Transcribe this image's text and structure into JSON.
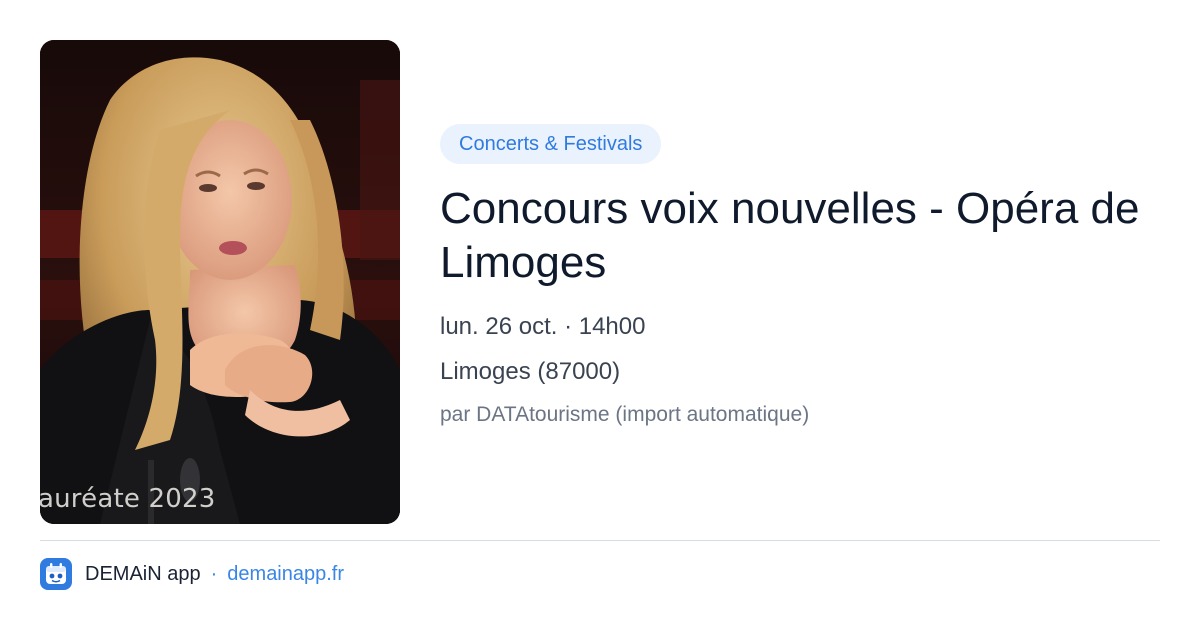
{
  "event": {
    "image_caption": "auréate 2023",
    "category": "Concerts & Festivals",
    "title": "Concours voix nouvelles - Opéra de Limoges",
    "date": "lun. 26 oct. · 14h00",
    "location": "Limoges (87000)",
    "source": "par DATAtourisme (import automatique)"
  },
  "footer": {
    "app_icon": "demain-app-icon",
    "app_name": "DEMAiN app",
    "separator": "·",
    "domain": "demainapp.fr"
  },
  "colors": {
    "accent": "#2f7be0",
    "pill_background": "#eaf2fd",
    "title": "#101a2d",
    "divider": "#d6dde3"
  }
}
